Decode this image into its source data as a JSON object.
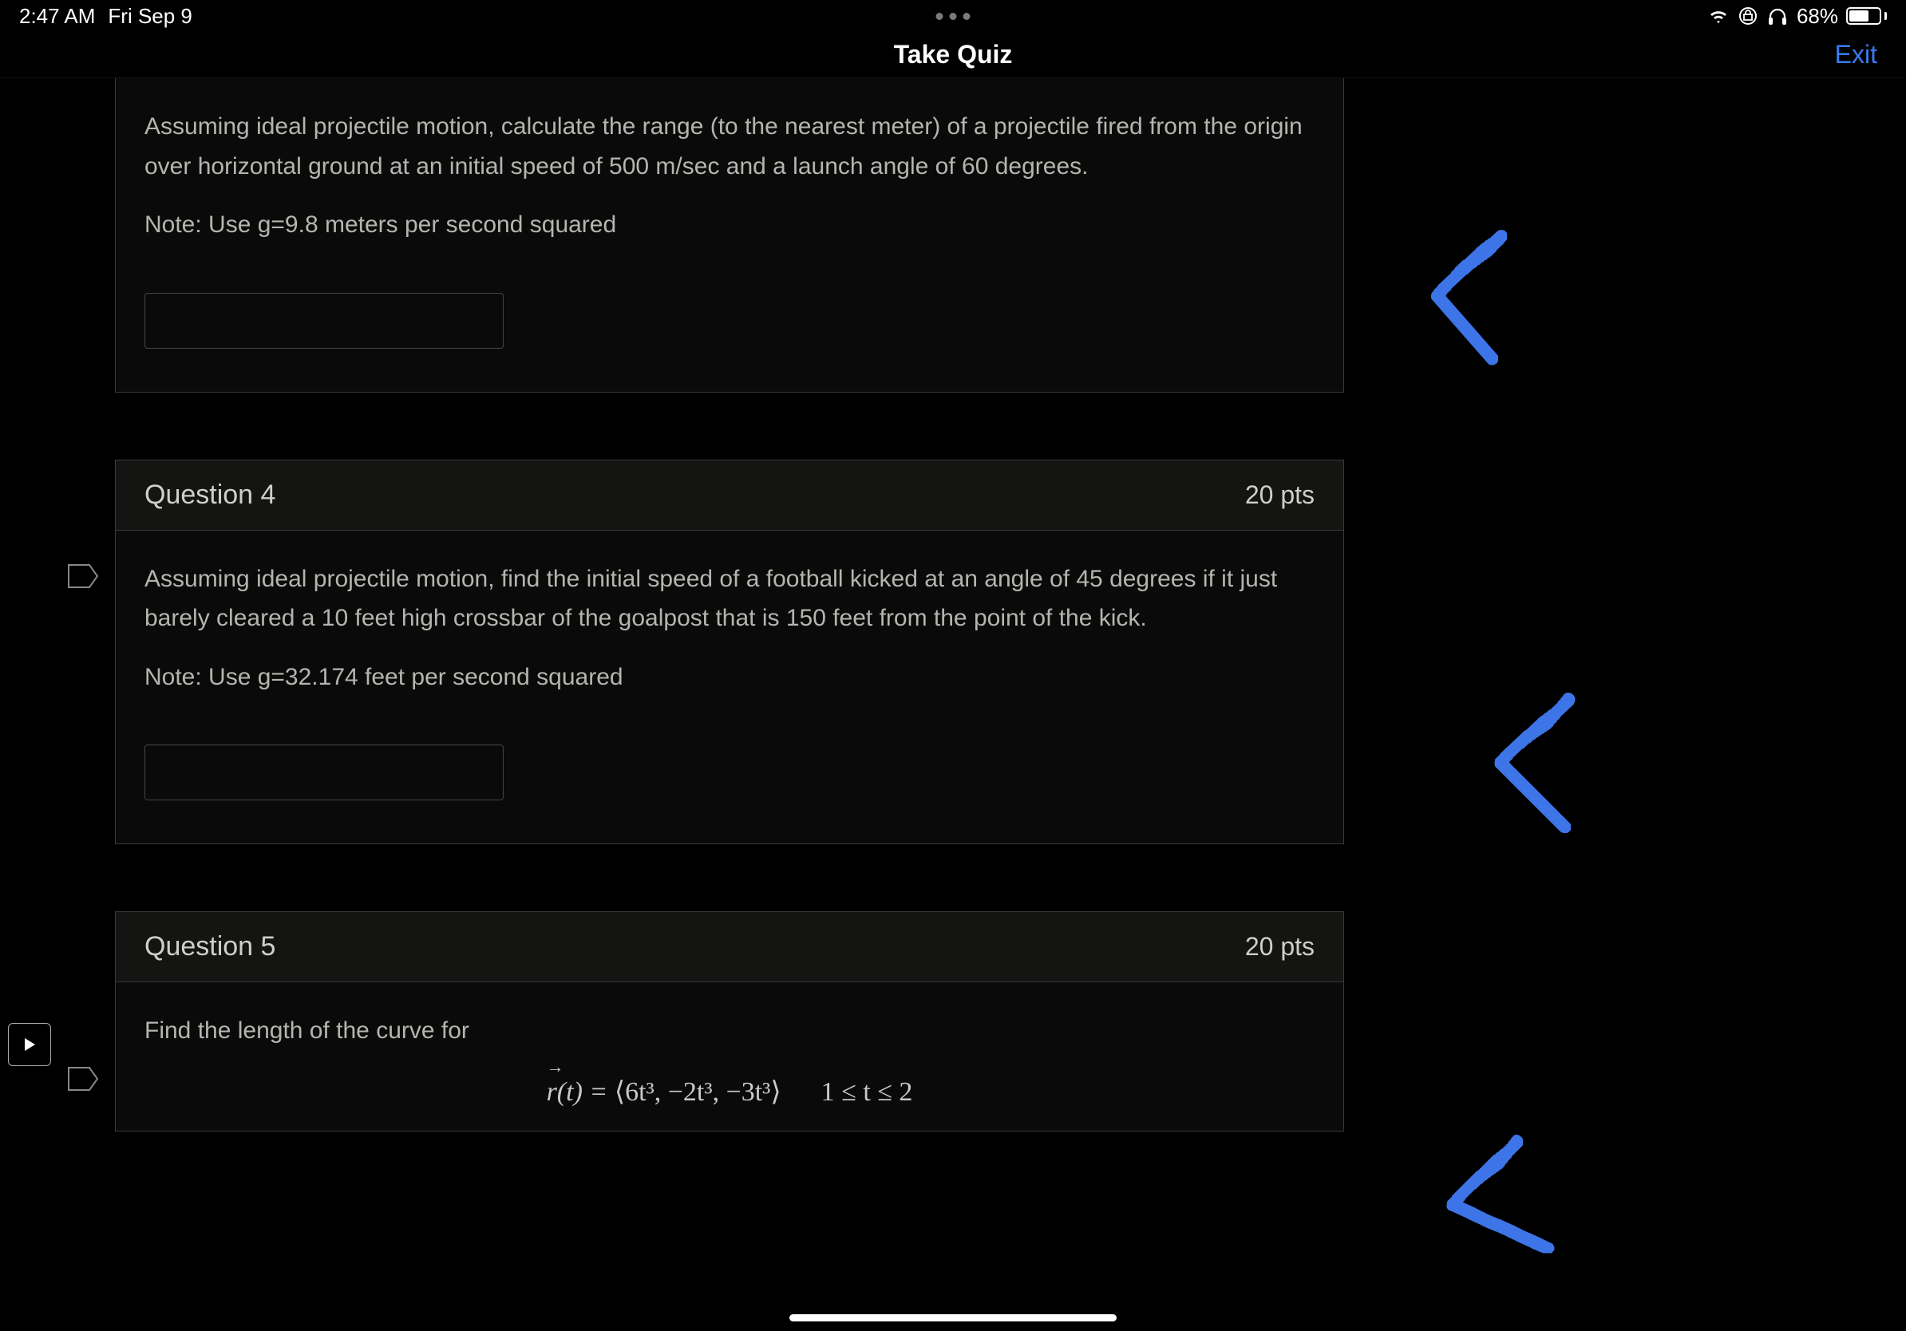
{
  "status": {
    "time": "2:47 AM",
    "date": "Fri Sep 9",
    "battery_pct": "68%"
  },
  "nav": {
    "title": "Take Quiz",
    "exit": "Exit"
  },
  "questions": {
    "q3": {
      "text1": "Assuming ideal projectile motion, calculate the range (to the nearest meter) of a projectile fired from the origin over horizontal ground at an initial speed of 500 m/sec and a launch angle of 60 degrees.",
      "text2": "Note: Use g=9.8 meters per second squared"
    },
    "q4": {
      "label": "Question 4",
      "pts": "20 pts",
      "text1": "Assuming ideal projectile motion, find the initial speed of a football kicked at an angle of 45 degrees if it just barely cleared a 10 feet high crossbar of the goalpost that is 150 feet from the point of the kick.",
      "text2": "Note: Use g=32.174 feet per second squared"
    },
    "q5": {
      "label": "Question 5",
      "pts": "20 pts",
      "text1": "Find the length of the curve for",
      "formula_lhs_var": "r",
      "formula_lhs_arg": "(t) = ",
      "formula_vec": "⟨6t³, −2t³, −3t³⟩",
      "formula_cond": "1 ≤ t ≤ 2"
    }
  }
}
